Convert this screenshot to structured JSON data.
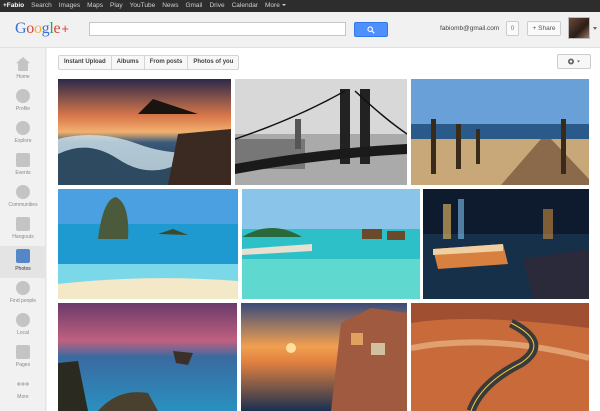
{
  "gbar": {
    "items": [
      "+Fabio",
      "Search",
      "Images",
      "Maps",
      "Play",
      "YouTube",
      "News",
      "Gmail",
      "Drive",
      "Calendar",
      "More"
    ]
  },
  "header": {
    "logo": "Google+",
    "search_value": "",
    "email": "fabiomb@gmail.com",
    "notification_count": "0",
    "share_label": "+ Share"
  },
  "nav": {
    "items": [
      "Home",
      "Profile",
      "Explore",
      "Events",
      "Communities",
      "Hangouts",
      "Photos",
      "Find people",
      "Local",
      "Pages",
      "More"
    ],
    "active": "Photos"
  },
  "tabs": [
    "Instant Upload",
    "Albums",
    "From posts",
    "Photos of you"
  ],
  "photos": [
    {
      "subject": "seascape-rocks-sunset"
    },
    {
      "subject": "manhattan-bridge-bw"
    },
    {
      "subject": "wooden-pier-beach"
    },
    {
      "subject": "tropical-rock-island"
    },
    {
      "subject": "overwater-bungalows"
    },
    {
      "subject": "harbor-night-city"
    },
    {
      "subject": "rocky-coast-twilight"
    },
    {
      "subject": "cliff-village-sunset"
    },
    {
      "subject": "desert-winding-road"
    }
  ],
  "colors": {
    "accent": "#4d90fe",
    "gbar": "#2d2d2d"
  }
}
